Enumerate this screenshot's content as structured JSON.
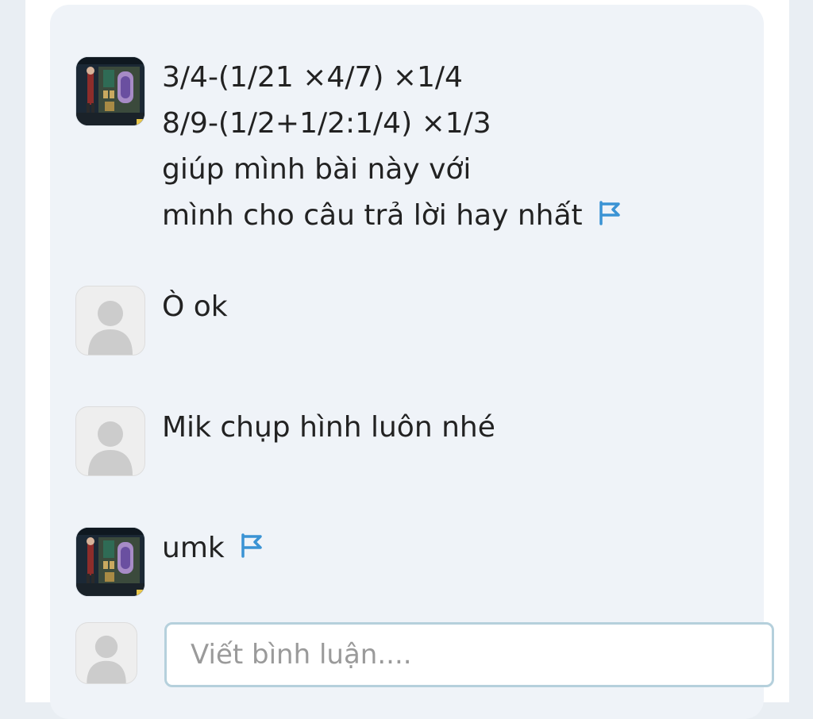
{
  "comments": [
    {
      "avatar": "user-game-avatar",
      "lines": [
        "3/4-(1/21 ×4/7) ×1/4",
        "8/9-(1/2+1/2:1/4) ×1/3",
        "giúp mình bài này với",
        "mình cho câu trả lời hay nhất"
      ],
      "flag": true
    },
    {
      "avatar": "default-user-avatar",
      "lines": [
        "Ò ok"
      ],
      "flag": false
    },
    {
      "avatar": "default-user-avatar",
      "lines": [
        "Mik chụp hình luôn nhé"
      ],
      "flag": false
    },
    {
      "avatar": "user-game-avatar",
      "lines": [
        "umk"
      ],
      "flag": true
    }
  ],
  "comment_input": {
    "placeholder": "Viết bình luận...."
  },
  "colors": {
    "flag": "#3a93d4",
    "card_bg": "#eff3f8",
    "input_border": "#b5d0dc"
  }
}
